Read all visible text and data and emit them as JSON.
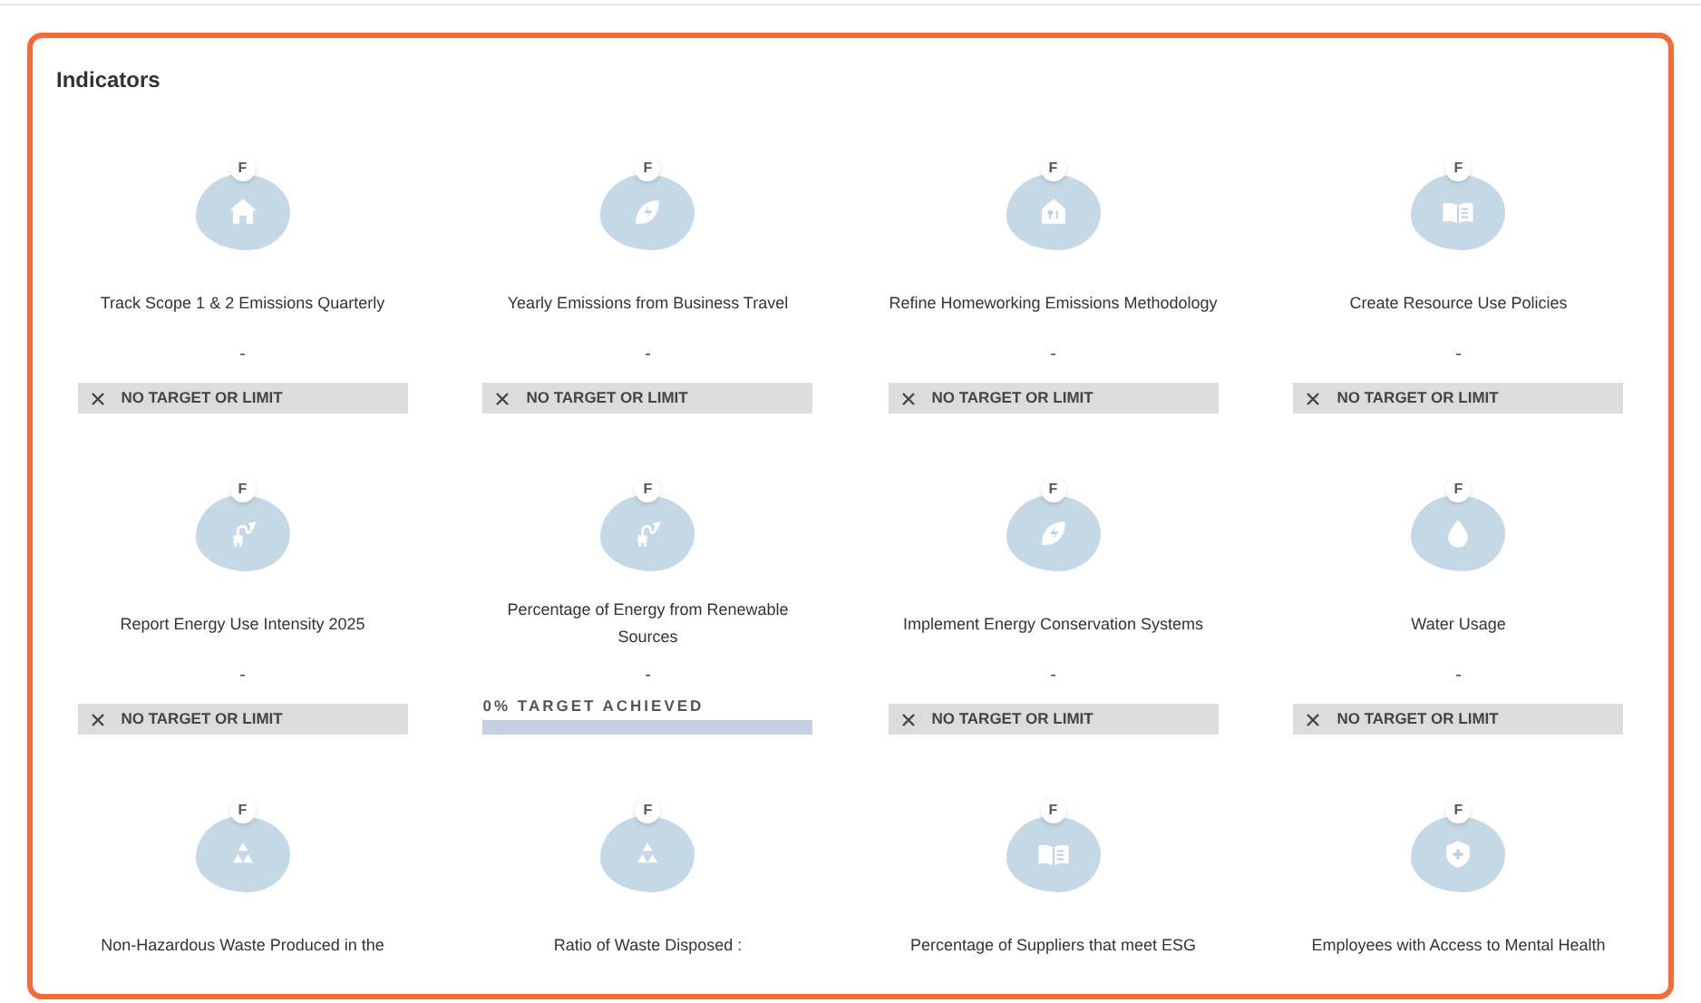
{
  "panel": {
    "title": "Indicators"
  },
  "indicators": [
    {
      "badge": "F",
      "title": "Track Scope 1 & 2 Emissions Quarterly",
      "value": "-",
      "target": {
        "kind": "none",
        "label": "NO TARGET OR LIMIT"
      }
    },
    {
      "badge": "F",
      "title": "Yearly Emissions from Business Travel",
      "value": "-",
      "target": {
        "kind": "none",
        "label": "NO TARGET OR LIMIT"
      }
    },
    {
      "badge": "F",
      "title": "Refine Homeworking Emissions Methodology",
      "value": "-",
      "target": {
        "kind": "none",
        "label": "NO TARGET OR LIMIT"
      }
    },
    {
      "badge": "F",
      "title": "Create Resource Use Policies",
      "value": "-",
      "target": {
        "kind": "none",
        "label": "NO TARGET OR LIMIT"
      }
    },
    {
      "badge": "F",
      "title": "Report Energy Use Intensity 2025",
      "value": "-",
      "target": {
        "kind": "none",
        "label": "NO TARGET OR LIMIT"
      }
    },
    {
      "badge": "F",
      "title": "Percentage of Energy from Renewable Sources",
      "value": "-",
      "target": {
        "kind": "progress",
        "label": "0% TARGET ACHIEVED",
        "level": 0
      }
    },
    {
      "badge": "F",
      "title": "Implement Energy Conservation Systems",
      "value": "-",
      "target": {
        "kind": "none",
        "label": "NO TARGET OR LIMIT"
      }
    },
    {
      "badge": "F",
      "title": "Water Usage",
      "value": "-",
      "target": {
        "kind": "none",
        "label": "NO TARGET OR LIMIT"
      }
    },
    {
      "badge": "F",
      "title": "Non-Hazardous Waste Produced in the"
    },
    {
      "badge": "F",
      "title": "Ratio of Waste Disposed :"
    },
    {
      "badge": "F",
      "title": "Percentage of Suppliers that meet ESG"
    },
    {
      "badge": "F",
      "title": "Employees with Access to Mental Health"
    }
  ]
}
